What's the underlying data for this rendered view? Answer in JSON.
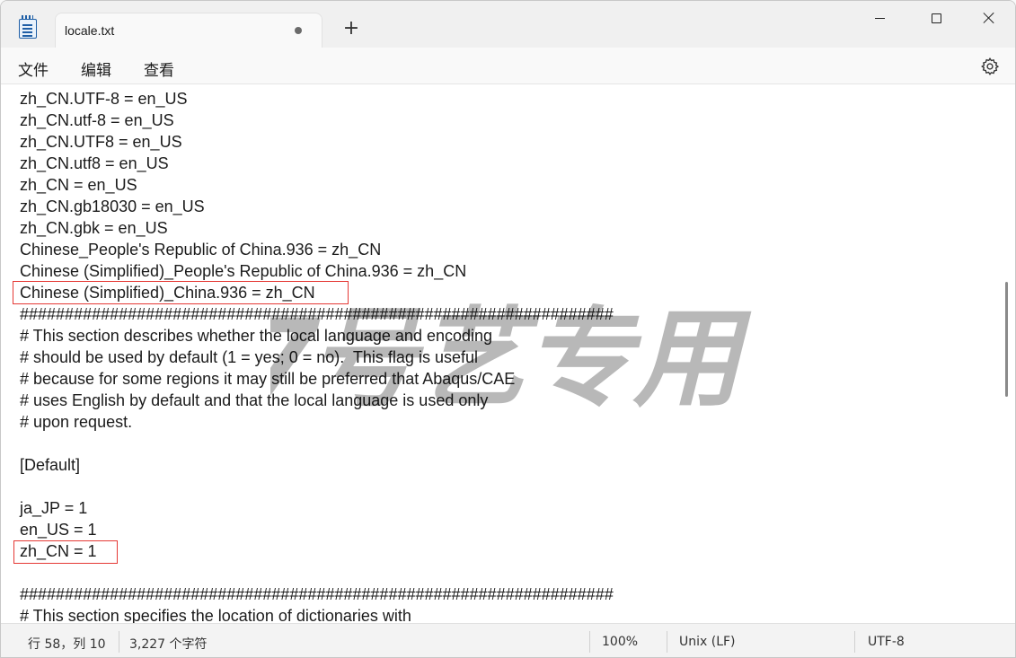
{
  "tab": {
    "title": "locale.txt"
  },
  "menu": {
    "file": "文件",
    "edit": "编辑",
    "view": "查看"
  },
  "editor": {
    "lines": [
      "zh_CN.UTF-8 = en_US",
      "zh_CN.utf-8 = en_US",
      "zh_CN.UTF8 = en_US",
      "zh_CN.utf8 = en_US",
      "zh_CN = en_US",
      "zh_CN.gb18030 = en_US",
      "zh_CN.gbk = en_US",
      "Chinese_People's Republic of China.936 = zh_CN",
      "Chinese (Simplified)_People's Republic of China.936 = zh_CN",
      "Chinese (Simplified)_China.936 = zh_CN",
      "##################################################################",
      "# This section describes whether the local language and encoding",
      "# should be used by default (1 = yes; 0 = no).  This flag is useful",
      "# because for some regions it may still be preferred that Abaqus/CAE",
      "# uses English by default and that the local language is used only",
      "# upon request.",
      "",
      "[Default]",
      "",
      "ja_JP = 1",
      "en_US = 1",
      "zh_CN = 1",
      "",
      "##################################################################",
      "# This section specifies the location of dictionaries with"
    ]
  },
  "watermark": {
    "text": "7号艺专用"
  },
  "status": {
    "position": "行 58，列 10",
    "chars": "3,227 个字符",
    "zoom": "100%",
    "line_ending": "Unix (LF)",
    "encoding": "UTF-8"
  },
  "colors": {
    "highlight": "#e53935",
    "titlebar": "#f0f0f0"
  }
}
